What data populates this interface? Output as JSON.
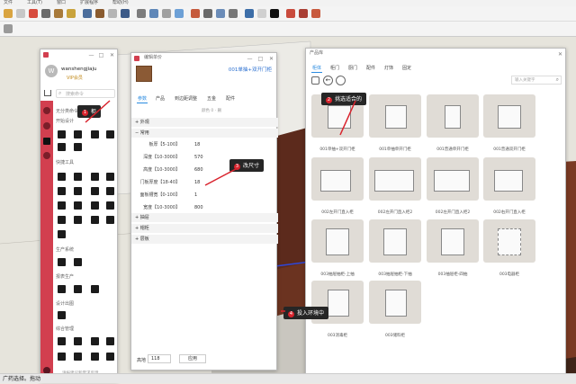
{
  "menu": [
    "文件",
    "工具(T)",
    "窗口",
    "扩展程序",
    "帮助(H)"
  ],
  "status_text": "广药选择。拖动",
  "left_panel": {
    "username": "wanshengjiaju",
    "vip": "VIP会员",
    "search_placeholder": "搜索命令",
    "sections": [
      "无分类命令",
      "开始设计",
      "快捷工具",
      "生产系统",
      "报表生产",
      "设计出图",
      "综合管理"
    ],
    "help_text": "请报建议和需求反馈"
  },
  "middle_panel": {
    "title": "编辑单价",
    "item_name": "001单抽+双开门柜",
    "tabs": [
      "参数",
      "产品",
      "到边距调整",
      "五金",
      "配件"
    ],
    "sub": "颜色 0 · 删",
    "groups": [
      "外观",
      "常用",
      "抽屉",
      "帽柜",
      "层板"
    ],
    "params": [
      {
        "label": "板厚【5-100】",
        "value": "18"
      },
      {
        "label": "深度【10-3000】",
        "value": "570"
      },
      {
        "label": "高度【10-3000】",
        "value": "680"
      },
      {
        "label": "门板厚度【18-40】",
        "value": "18"
      },
      {
        "label": "面板槽宽【0-100】",
        "value": "1"
      },
      {
        "label": "宽度【10-3000】",
        "value": "800"
      }
    ],
    "footer_label": "高地",
    "footer_value": "118",
    "apply": "应用"
  },
  "right_panel": {
    "title": "产品库",
    "tabs": [
      "柜体",
      "柜门",
      "厨门",
      "配件",
      "灯饰",
      "固定"
    ],
    "search_placeholder": "输入关键字",
    "products": [
      "001单抽+双开门柜",
      "001单抽单开门柜",
      "001普通单开门柜",
      "001普通双开门柜",
      "002左开门直入柜",
      "002左开门直入柜2",
      "002左开门直入柜2",
      "002右开门直入柜",
      "002右开门直入柜2",
      "003抽屉抽柜-上抽",
      "003抽屉抽柜-下抽",
      "003抽屉柜-四抽",
      "003电器柜",
      "003消毒柜",
      "003储料柜"
    ]
  },
  "annotations": [
    {
      "n": "1",
      "text": "柜"
    },
    {
      "n": "2",
      "text": "挑选适合的"
    },
    {
      "n": "3",
      "text": "改尺寸"
    },
    {
      "n": "4",
      "text": "投入环境中"
    }
  ],
  "colors": {
    "accent_red": "#d23f4f",
    "tab_blue": "#2a8be0",
    "tag_bg": "#262626"
  }
}
